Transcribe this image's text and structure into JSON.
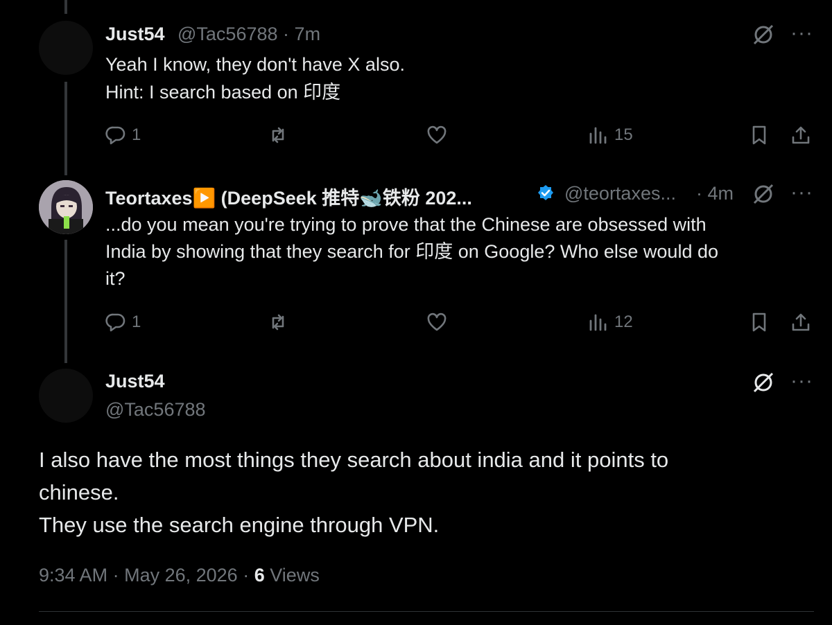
{
  "reply1": {
    "display_name": "Just54",
    "handle": "@Tac56788",
    "separator": "·",
    "time": "7m",
    "text_line1": "Yeah I know, they don't have X also.",
    "text_line2": "Hint: I search based on 印度",
    "replies": "1",
    "views": "15"
  },
  "reply2": {
    "display_name": "Teortaxes▶️ (DeepSeek 推特🐋铁粉 202...",
    "handle": "@teortaxes...",
    "separator": "·",
    "time": "4m",
    "text_line1": "...do you mean you're trying to prove that the Chinese are obsessed with",
    "text_line2": "India by showing that they search for 印度 on Google? Who else would do",
    "text_line3": "it?",
    "replies": "1",
    "views": "12"
  },
  "main_post": {
    "display_name": "Just54",
    "handle": "@Tac56788",
    "text_line1": "I also have the most things they search about india and it points to",
    "text_line2": "chinese.",
    "text_line3": "They use the search engine through VPN.",
    "time": "9:34 AM",
    "separator1": "·",
    "date": "May 26, 2026",
    "separator2": "·",
    "views_count": "6",
    "views_label": "Views"
  },
  "icons": {
    "reply": "reply-icon",
    "repost": "repost-icon",
    "like": "heart-icon",
    "views": "views-icon",
    "bookmark": "bookmark-icon",
    "share": "share-icon",
    "grok": "grok-icon",
    "more": "more-icon",
    "verified": "verified-badge-icon"
  },
  "colors": {
    "background": "#000000",
    "text": "#e7e9ea",
    "muted": "#71767b",
    "verified": "#1d9bf0",
    "divider": "#2f3336"
  }
}
